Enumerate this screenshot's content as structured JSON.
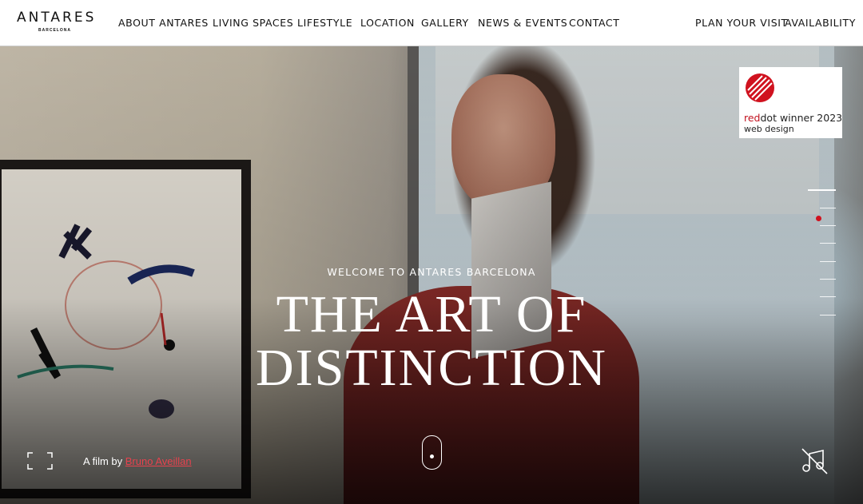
{
  "header": {
    "logo": {
      "name": "ANTARES",
      "sub": "BARCELONA"
    },
    "nav": [
      {
        "label": "ABOUT ANTARES"
      },
      {
        "label": "LIVING SPACES"
      },
      {
        "label": "LIFESTYLE"
      },
      {
        "label": "LOCATION"
      },
      {
        "label": "GALLERY"
      },
      {
        "label": "NEWS & EVENTS"
      },
      {
        "label": "CONTACT"
      }
    ],
    "right_nav": [
      {
        "label": "PLAN YOUR VISIT"
      },
      {
        "label": "AVAILABILITY"
      }
    ]
  },
  "badge": {
    "brand_red": "red",
    "brand_dot": "dot",
    "award_text": " winner 2023",
    "category": "web design"
  },
  "hero": {
    "kicker": "WELCOME TO ANTARES BARCELONA",
    "headline_line1": "THE ART OF",
    "headline_line2": "DISTINCTION",
    "film_prefix": "A film by ",
    "film_author": "Bruno Aveillan"
  },
  "slides": {
    "count": 8,
    "active_index": 0
  },
  "colors": {
    "accent_red": "#d0121f",
    "link_red": "#e8424e",
    "header_bg": "#ffffff",
    "text_dark": "#111111"
  },
  "icons": {
    "fullscreen": "fullscreen-icon",
    "scroll": "scroll-mouse-icon",
    "mute": "music-muted-icon",
    "reddot": "reddot-logo-icon"
  }
}
